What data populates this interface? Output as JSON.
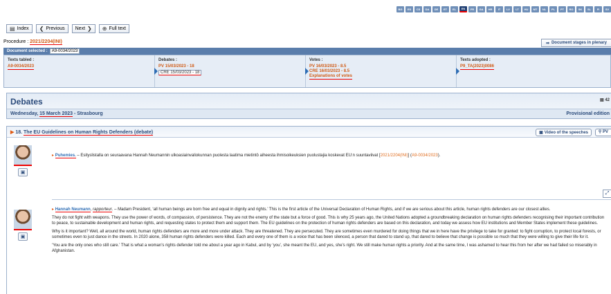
{
  "languages": [
    {
      "code": "BG",
      "active": false
    },
    {
      "code": "ES",
      "active": false
    },
    {
      "code": "CS",
      "active": false
    },
    {
      "code": "DA",
      "active": false
    },
    {
      "code": "DE",
      "active": false
    },
    {
      "code": "ET",
      "active": false
    },
    {
      "code": "EL",
      "active": false
    },
    {
      "code": "EN",
      "active": true
    },
    {
      "code": "FR",
      "active": false
    },
    {
      "code": "GA",
      "active": false
    },
    {
      "code": "HR",
      "active": false
    },
    {
      "code": "IT",
      "active": false
    },
    {
      "code": "LV",
      "active": false
    },
    {
      "code": "LT",
      "active": false
    },
    {
      "code": "HU",
      "active": false
    },
    {
      "code": "MT",
      "active": false
    },
    {
      "code": "NL",
      "active": false
    },
    {
      "code": "PL",
      "active": false
    },
    {
      "code": "PT",
      "active": false
    },
    {
      "code": "RO",
      "active": false
    },
    {
      "code": "SK",
      "active": false
    },
    {
      "code": "SL",
      "active": false
    },
    {
      "code": "FI",
      "active": false
    },
    {
      "code": "SV",
      "active": false
    }
  ],
  "toolbar": {
    "index": "Index",
    "previous": "Previous",
    "next": "Next",
    "full_text": "Full text"
  },
  "procedure": {
    "label": "Procedure :",
    "value": "2021/2204(INI)"
  },
  "stages_button": "Document stages in plenary",
  "document_selected": {
    "label": "Document selected :",
    "value": "A9-0034/2023"
  },
  "stages": {
    "texts_tabled": {
      "header": "Texts tabled :",
      "links": [
        "A9-0034/2023"
      ]
    },
    "debates": {
      "header": "Debates :",
      "pv": "PV 15/03/2023 - 18",
      "cre": "CRE 15/03/2023 - 18"
    },
    "votes": {
      "header": "Votes :",
      "links": [
        "PV 16/03/2023 - 8.5",
        "CRE 16/03/2023 - 8.5",
        "Explanations of votes"
      ]
    },
    "texts_adopted": {
      "header": "Texts adopted :",
      "links": [
        "P9_TA(2023)0086"
      ]
    }
  },
  "debates": {
    "title": "Debates",
    "pages": "42",
    "date_prefix": "Wednesday, ",
    "date": "15 March 2023",
    "location": " - Strasbourg",
    "provisional": "Provisional edition"
  },
  "item": {
    "number": "18.",
    "title": "The EU Guidelines on Human Rights Defenders (debate)",
    "video_button": "Video of the speeches",
    "pv_button": "PV"
  },
  "speech1": {
    "speaker": "Puhemies.",
    "text": " – Esityslistalla on seuraavana Hannah Neumannin ulkoasiainvaliokunnan puolesta laatima mietintö aiheesta ihmisoikeuksien puolustajia koskevat EU:n suuntaviivat [",
    "proc_ref": "2021/2204(INI)",
    "mid": "] (",
    "doc_ref": "A9-0034/2023",
    "end": ")."
  },
  "speech2": {
    "speaker": "Hannah Neumann",
    "role": "rapporteur",
    "paragraphs": [
      ". – Madam President, ‘all human beings are born free and equal in dignity and rights.’ This is the first article of the Universal Declaration of Human Rights, and if we are serious about this article, human rights defenders are our closest allies.",
      "They do not fight with weapons. They use the power of words, of compassion, of persistence. They are not the enemy of the state but a force of good. This is why 25 years ago, the United Nations adopted a groundbreaking declaration on human rights defenders recognising their important contribution to peace, to sustainable development and human rights, and requesting states to protect them and support them. The EU guidelines on the protection of human rights defenders are based on this declaration, and today we assess how EU institutions and Member States implement these guidelines.",
      "Why is it important? Well, all around the world, human rights defenders are more and more under attack. They are threatened. They are persecuted. They are sometimes even murdered for doing things that we in here have the privilege to take for granted: to fight corruption, to protect local forests, or sometimes even to just dance in the streets. In 2020 alone, 358 human rights defenders were killed. Each and every one of them is a voice that has been silenced, a person that dared to stand up, that dared to believe that change is possible so much that they were willing to give their life for it.",
      "‘You are the only ones who still care.’ That is what a woman’s rights defender told me about a year ago in Kabul, and by ‘you’, she meant the EU, and yes, she’s right. We still make human rights a priority. And at the same time, I was ashamed to hear this from her after we had failed so miserably in Afghanistan."
    ]
  },
  "colors": {
    "accent_link": "#d05a14",
    "header_blue": "#5a7dab",
    "annotation_red": "#ee0000"
  }
}
